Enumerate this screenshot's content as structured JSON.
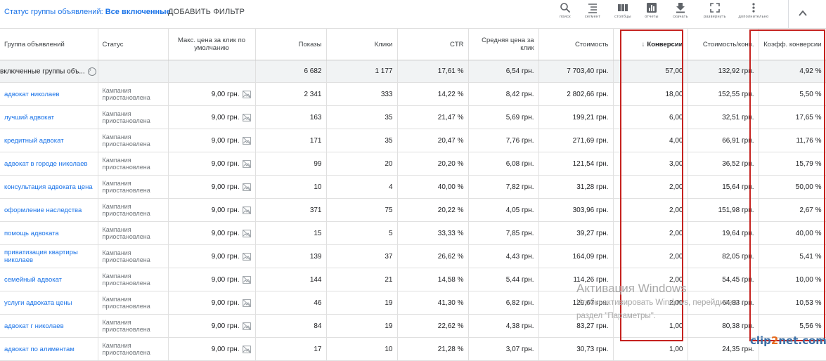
{
  "filter": {
    "status_prefix": "Статус группы объявлений:",
    "status_value": "Все включенные",
    "add_filter_label": "ДОБАВИТЬ ФИЛЬТР"
  },
  "toolbar": {
    "tools": [
      {
        "label": "поиск",
        "icon": "search-icon"
      },
      {
        "label": "сегмент",
        "icon": "segment-icon"
      },
      {
        "label": "столбцы",
        "icon": "columns-icon"
      },
      {
        "label": "отчеты",
        "icon": "reports-icon"
      },
      {
        "label": "скачать",
        "icon": "download-icon"
      },
      {
        "label": "развернуть",
        "icon": "expand-icon"
      },
      {
        "label": "дополнительно",
        "icon": "more-icon"
      }
    ],
    "collapse_icon": "chevron-up-icon"
  },
  "columns": {
    "group": "Группа объявлений",
    "status": "Статус",
    "max_cpc": "Макс. цена за клик по умолчанию",
    "impressions": "Показы",
    "clicks": "Клики",
    "ctr": "CTR",
    "avg_cpc": "Средняя цена за клик",
    "cost": "Стоимость",
    "sort_arrow": "↓",
    "conversions": "Конверсии",
    "cost_per_conv": "Стоимость/конв.",
    "conv_rate": "Коэфф. конверсии"
  },
  "total": {
    "label": "включенные группы объ...",
    "help": "?",
    "impressions": "6 682",
    "clicks": "1 177",
    "ctr": "17,61 %",
    "avg_cpc": "6,54 грн.",
    "cost": "7 703,40 грн.",
    "conversions": "57,00",
    "cost_per_conv": "132,92 грн.",
    "conv_rate": "4,92 %"
  },
  "rows": [
    {
      "name": "адвокат николаев",
      "status": "Кампания приостановлена",
      "bid": "9,00 грн.",
      "impressions": "2 341",
      "clicks": "333",
      "ctr": "14,22 %",
      "avg_cpc": "8,42 грн.",
      "cost": "2 802,66 грн.",
      "conversions": "18,00",
      "cost_per_conv": "152,55 грн.",
      "conv_rate": "5,50 %"
    },
    {
      "name": "лучший адвокат",
      "status": "Кампания приостановлена",
      "bid": "9,00 грн.",
      "impressions": "163",
      "clicks": "35",
      "ctr": "21,47 %",
      "avg_cpc": "5,69 грн.",
      "cost": "199,21 грн.",
      "conversions": "6,00",
      "cost_per_conv": "32,51 грн.",
      "conv_rate": "17,65 %"
    },
    {
      "name": "кредитный адвокат",
      "status": "Кампания приостановлена",
      "bid": "9,00 грн.",
      "impressions": "171",
      "clicks": "35",
      "ctr": "20,47 %",
      "avg_cpc": "7,76 грн.",
      "cost": "271,69 грн.",
      "conversions": "4,00",
      "cost_per_conv": "66,91 грн.",
      "conv_rate": "11,76 %"
    },
    {
      "name": "адвокат в городе николаев",
      "status": "Кампания приостановлена",
      "bid": "9,00 грн.",
      "impressions": "99",
      "clicks": "20",
      "ctr": "20,20 %",
      "avg_cpc": "6,08 грн.",
      "cost": "121,54 грн.",
      "conversions": "3,00",
      "cost_per_conv": "36,52 грн.",
      "conv_rate": "15,79 %"
    },
    {
      "name": "консультация адвоката цена",
      "status": "Кампания приостановлена",
      "bid": "9,00 грн.",
      "impressions": "10",
      "clicks": "4",
      "ctr": "40,00 %",
      "avg_cpc": "7,82 грн.",
      "cost": "31,28 грн.",
      "conversions": "2,00",
      "cost_per_conv": "15,64 грн.",
      "conv_rate": "50,00 %"
    },
    {
      "name": "оформление наследства",
      "status": "Кампания приостановлена",
      "bid": "9,00 грн.",
      "impressions": "371",
      "clicks": "75",
      "ctr": "20,22 %",
      "avg_cpc": "4,05 грн.",
      "cost": "303,96 грн.",
      "conversions": "2,00",
      "cost_per_conv": "151,98 грн.",
      "conv_rate": "2,67 %"
    },
    {
      "name": "помощь адвоката",
      "status": "Кампания приостановлена",
      "bid": "9,00 грн.",
      "impressions": "15",
      "clicks": "5",
      "ctr": "33,33 %",
      "avg_cpc": "7,85 грн.",
      "cost": "39,27 грн.",
      "conversions": "2,00",
      "cost_per_conv": "19,64 грн.",
      "conv_rate": "40,00 %"
    },
    {
      "name": "приватизация квартиры николаев",
      "status": "Кампания приостановлена",
      "bid": "9,00 грн.",
      "impressions": "139",
      "clicks": "37",
      "ctr": "26,62 %",
      "avg_cpc": "4,43 грн.",
      "cost": "164,09 грн.",
      "conversions": "2,00",
      "cost_per_conv": "82,05 грн.",
      "conv_rate": "5,41 %"
    },
    {
      "name": "семейный адвокат",
      "status": "Кампания приостановлена",
      "bid": "9,00 грн.",
      "impressions": "144",
      "clicks": "21",
      "ctr": "14,58 %",
      "avg_cpc": "5,44 грн.",
      "cost": "114,26 грн.",
      "conversions": "2,00",
      "cost_per_conv": "54,45 грн.",
      "conv_rate": "10,00 %"
    },
    {
      "name": "услуги адвоката цены",
      "status": "Кампания приостановлена",
      "bid": "9,00 грн.",
      "impressions": "46",
      "clicks": "19",
      "ctr": "41,30 %",
      "avg_cpc": "6,82 грн.",
      "cost": "129,67 грн.",
      "conversions": "2,00",
      "cost_per_conv": "64,83 грн.",
      "conv_rate": "10,53 %"
    },
    {
      "name": "адвокат г николаев",
      "status": "Кампания приостановлена",
      "bid": "9,00 грн.",
      "impressions": "84",
      "clicks": "19",
      "ctr": "22,62 %",
      "avg_cpc": "4,38 грн.",
      "cost": "83,27 грн.",
      "conversions": "1,00",
      "cost_per_conv": "80,38 грн.",
      "conv_rate": "5,56 %"
    },
    {
      "name": "адвокат по алиментам",
      "status": "Кампания приостановлена",
      "bid": "9,00 грн.",
      "impressions": "17",
      "clicks": "10",
      "ctr": "21,28 %",
      "avg_cpc": "3,07 грн.",
      "cost": "30,73 грн.",
      "conversions": "1,00",
      "cost_per_conv": "24,35 грн.",
      "conv_rate": ""
    }
  ],
  "watermark": {
    "title": "Активация Windows",
    "line1": "Чтобы активировать Windows, перейдите в",
    "line2": "раздел \"Параметры\"."
  },
  "logo": {
    "part1": "clip",
    "part2": "2",
    "part3": "net.com"
  },
  "colors": {
    "link": "#1a73e8",
    "highlight": "#c5221f",
    "total_bg": "#f1f3f4"
  }
}
